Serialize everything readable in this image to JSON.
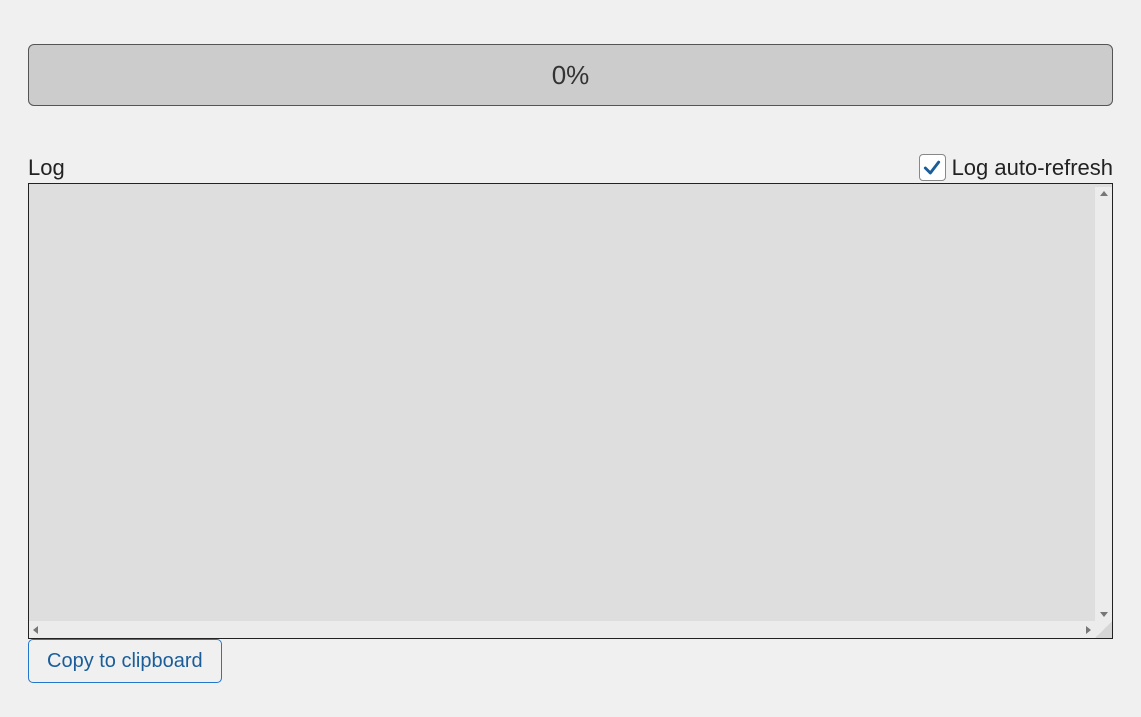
{
  "progress": {
    "text": "0%",
    "percent": 0
  },
  "log": {
    "label": "Log",
    "content": "",
    "auto_refresh_label": "Log auto-refresh",
    "auto_refresh_checked": true
  },
  "buttons": {
    "copy_label": "Copy to clipboard"
  },
  "colors": {
    "page_bg": "#f0f0f0",
    "progress_bg": "#cccccc",
    "log_bg": "#dedede",
    "button_border": "#2277cc",
    "button_text": "#1a5d99",
    "check_color": "#1a5d99"
  }
}
